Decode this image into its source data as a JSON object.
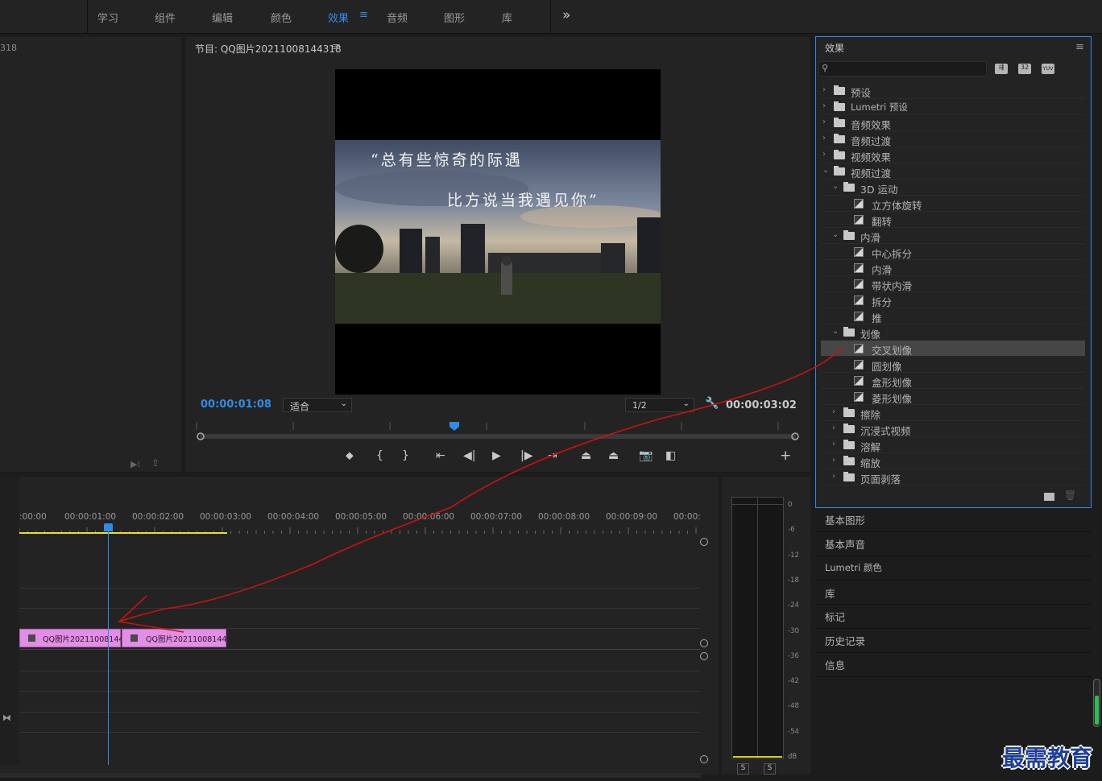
{
  "workspaces": [
    "学习",
    "组件",
    "编辑",
    "颜色",
    "效果",
    "音频",
    "图形",
    "库"
  ],
  "workspace_active": "效果",
  "more_glyph": "»",
  "source_panel": {
    "title_fragment": "318"
  },
  "program": {
    "title": "节目: QQ图片20211008144318",
    "timecode": "00:00:01:08",
    "fit": "适合",
    "resolution": "1/2",
    "duration": "00:00:03:02",
    "caption_line1": "“总有些惊奇的际遇",
    "caption_line2": "比方说当我遇见你”"
  },
  "effects": {
    "title": "效果",
    "rows": [
      {
        "label": "预设",
        "level": 0,
        "kind": "folder-star",
        "open": false
      },
      {
        "label": "Lumetri 预设",
        "level": 0,
        "kind": "folder-star",
        "open": false
      },
      {
        "label": "音频效果",
        "level": 0,
        "kind": "folder",
        "open": false
      },
      {
        "label": "音频过渡",
        "level": 0,
        "kind": "folder",
        "open": false
      },
      {
        "label": "视频效果",
        "level": 0,
        "kind": "folder",
        "open": false
      },
      {
        "label": "视频过渡",
        "level": 0,
        "kind": "folder",
        "open": true
      },
      {
        "label": "3D 运动",
        "level": 1,
        "kind": "folder",
        "open": true
      },
      {
        "label": "立方体旋转",
        "level": 2,
        "kind": "effect"
      },
      {
        "label": "翻转",
        "level": 2,
        "kind": "effect"
      },
      {
        "label": "内滑",
        "level": 1,
        "kind": "folder",
        "open": true
      },
      {
        "label": "中心拆分",
        "level": 2,
        "kind": "effect"
      },
      {
        "label": "内滑",
        "level": 2,
        "kind": "effect"
      },
      {
        "label": "带状内滑",
        "level": 2,
        "kind": "effect"
      },
      {
        "label": "拆分",
        "level": 2,
        "kind": "effect"
      },
      {
        "label": "推",
        "level": 2,
        "kind": "effect"
      },
      {
        "label": "划像",
        "level": 1,
        "kind": "folder",
        "open": true
      },
      {
        "label": "交叉划像",
        "level": 2,
        "kind": "effect",
        "selected": true
      },
      {
        "label": "圆划像",
        "level": 2,
        "kind": "effect"
      },
      {
        "label": "盒形划像",
        "level": 2,
        "kind": "effect"
      },
      {
        "label": "菱形划像",
        "level": 2,
        "kind": "effect"
      },
      {
        "label": "擦除",
        "level": 1,
        "kind": "folder",
        "open": false
      },
      {
        "label": "沉浸式视频",
        "level": 1,
        "kind": "folder",
        "open": false
      },
      {
        "label": "溶解",
        "level": 1,
        "kind": "folder",
        "open": false
      },
      {
        "label": "缩放",
        "level": 1,
        "kind": "folder",
        "open": false
      },
      {
        "label": "页面剥落",
        "level": 1,
        "kind": "folder",
        "open": false
      }
    ],
    "filter_labels": [
      "32",
      "YUV"
    ]
  },
  "side_panels": [
    "基本图形",
    "基本声音",
    "Lumetri 颜色",
    "库",
    "标记",
    "历史记录",
    "信息"
  ],
  "timeline": {
    "ruler": [
      ":00:00",
      "00:00:01:00",
      "00:00:02:00",
      "00:00:03:00",
      "00:00:04:00",
      "00:00:05:00",
      "00:00:06:00",
      "00:00:07:00",
      "00:00:08:00",
      "00:00:09:00",
      "00:00:"
    ],
    "clips": [
      "QQ图片20211008144",
      "QQ图片202110081443"
    ]
  },
  "meter": {
    "scale": [
      "0",
      "-6",
      "-12",
      "-18",
      "-24",
      "-30",
      "-36",
      "-42",
      "-48",
      "-54",
      "dB"
    ],
    "solo": [
      "S",
      "S"
    ]
  },
  "watermark": "最需教育",
  "colors": {
    "accent": "#2d8ceb",
    "clip": "#e38ee6",
    "annotation": "#cc1111",
    "work_area": "#e8e02a"
  }
}
